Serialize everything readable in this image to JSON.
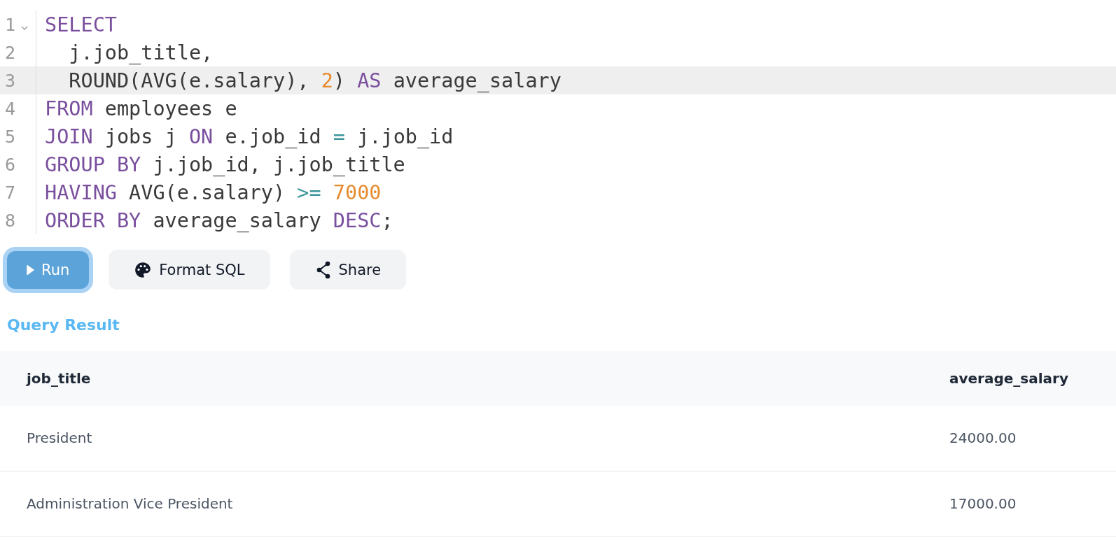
{
  "editor": {
    "lines": [
      {
        "number": "1",
        "active": false,
        "foldable": true,
        "tokens": [
          {
            "kind": "keyword",
            "text": "SELECT"
          }
        ]
      },
      {
        "number": "2",
        "active": false,
        "foldable": false,
        "tokens": [
          {
            "kind": "plain",
            "text": "  j.job_title,"
          }
        ]
      },
      {
        "number": "3",
        "active": true,
        "foldable": false,
        "tokens": [
          {
            "kind": "plain",
            "text": "  ROUND(AVG(e.salary), "
          },
          {
            "kind": "number",
            "text": "2"
          },
          {
            "kind": "plain",
            "text": ") "
          },
          {
            "kind": "keyword",
            "text": "AS"
          },
          {
            "kind": "plain",
            "text": " average_salary"
          }
        ]
      },
      {
        "number": "4",
        "active": false,
        "foldable": false,
        "tokens": [
          {
            "kind": "keyword",
            "text": "FROM"
          },
          {
            "kind": "plain",
            "text": " employees e"
          }
        ]
      },
      {
        "number": "5",
        "active": false,
        "foldable": false,
        "tokens": [
          {
            "kind": "keyword",
            "text": "JOIN"
          },
          {
            "kind": "plain",
            "text": " jobs j "
          },
          {
            "kind": "keyword",
            "text": "ON"
          },
          {
            "kind": "plain",
            "text": " e.job_id "
          },
          {
            "kind": "operator",
            "text": "="
          },
          {
            "kind": "plain",
            "text": " j.job_id"
          }
        ]
      },
      {
        "number": "6",
        "active": false,
        "foldable": false,
        "tokens": [
          {
            "kind": "keyword",
            "text": "GROUP BY"
          },
          {
            "kind": "plain",
            "text": " j.job_id, j.job_title"
          }
        ]
      },
      {
        "number": "7",
        "active": false,
        "foldable": false,
        "tokens": [
          {
            "kind": "keyword",
            "text": "HAVING"
          },
          {
            "kind": "plain",
            "text": " AVG(e.salary) "
          },
          {
            "kind": "operator",
            "text": ">="
          },
          {
            "kind": "number",
            "text": " 7000"
          }
        ]
      },
      {
        "number": "8",
        "active": false,
        "foldable": false,
        "tokens": [
          {
            "kind": "keyword",
            "text": "ORDER BY"
          },
          {
            "kind": "plain",
            "text": " average_salary "
          },
          {
            "kind": "keyword",
            "text": "DESC"
          },
          {
            "kind": "plain",
            "text": ";"
          }
        ]
      }
    ]
  },
  "buttons": [
    {
      "kind": "run",
      "label": "Run",
      "focused": true
    },
    {
      "kind": "format",
      "label": "Format SQL",
      "focused": false
    },
    {
      "kind": "share",
      "label": "Share",
      "focused": false
    }
  ],
  "result": {
    "title": "Query Result",
    "columns": [
      "job_title",
      "average_salary"
    ],
    "rows": [
      [
        "President",
        "24000.00"
      ],
      [
        "Administration Vice President",
        "17000.00"
      ]
    ]
  }
}
